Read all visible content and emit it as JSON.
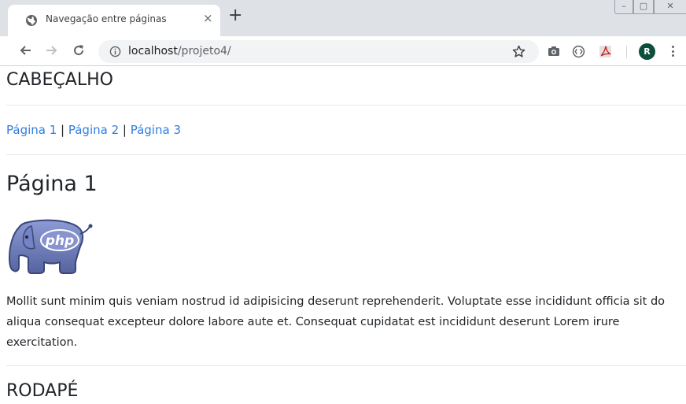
{
  "browser": {
    "tab_title": "Navegação entre páginas",
    "tab_close": "×",
    "new_tab": "+",
    "url_host": "localhost",
    "url_path": "/projeto4/",
    "profile_initial": "R",
    "window_controls": {
      "minimize": "–",
      "maximize": "▢",
      "close": "✕"
    }
  },
  "page": {
    "header": "CABEÇALHO",
    "nav": {
      "links": [
        "Página 1",
        "Página 2",
        "Página 3"
      ],
      "separator": " | "
    },
    "title": "Página 1",
    "logo_text": "php",
    "paragraph": "Mollit sunt minim quis veniam nostrud id adipisicing deserunt reprehenderit. Voluptate esse incididunt officia sit do aliqua consequat excepteur dolore labore aute et. Consequat cupidatat est incididunt deserunt Lorem irure exercitation.",
    "footer": "RODAPÉ"
  },
  "colors": {
    "link": "#2f7ee0",
    "profile_bg": "#0b4f3c",
    "tabbar_bg": "#dee1e6",
    "elephant": "#6f7fbf"
  },
  "icons": [
    "globe-icon",
    "back-arrow-icon",
    "forward-arrow-icon",
    "reload-icon",
    "info-icon",
    "star-icon",
    "camera-icon",
    "extension-icon",
    "pdf-icon",
    "kebab-menu-icon"
  ]
}
